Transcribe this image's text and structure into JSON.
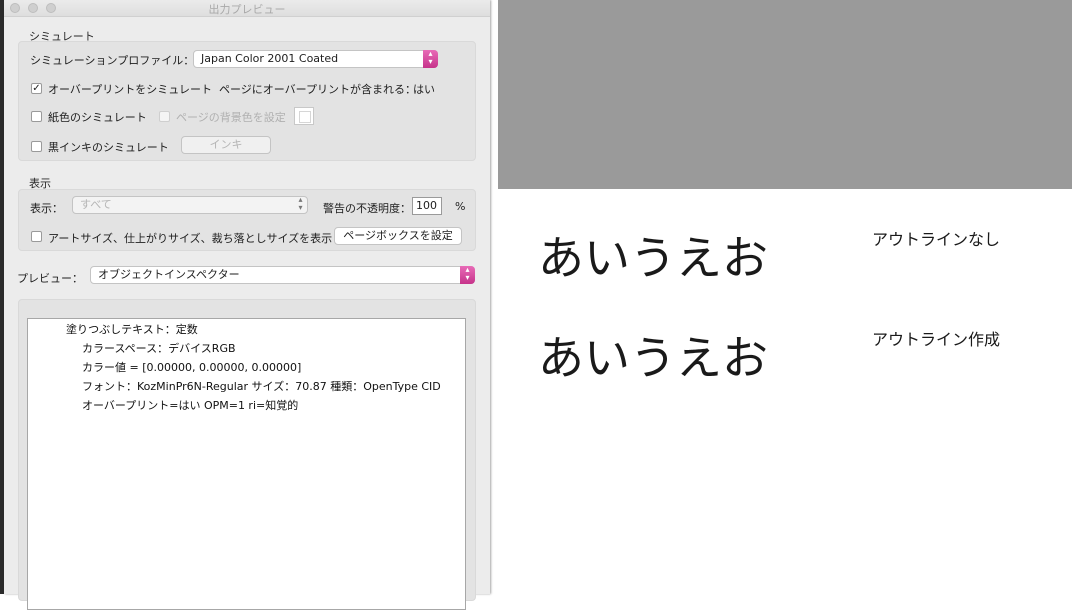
{
  "window": {
    "title": "出力プレビュー"
  },
  "simulate": {
    "section_label": "シミュレート",
    "profile_label": "シミュレーションプロファイル：",
    "profile_value": "Japan Color 2001 Coated",
    "overprint_label": "オーバープリントをシミュレート",
    "overprint_checked": "✓",
    "page_overprint_label": "ページにオーバープリントが含まれる：",
    "page_overprint_value": "はい",
    "paper_color_label": "紙色のシミュレート",
    "bg_color_label": "ページの背景色を設定",
    "black_ink_label": "黒インキのシミュレート",
    "ink_button": "インキ"
  },
  "display": {
    "section_label": "表示",
    "show_label": "表示：",
    "show_value": "すべて",
    "opacity_label": "警告の不透明度：",
    "opacity_value": "100",
    "opacity_unit": "%",
    "sizes_label": "アートサイズ、仕上がりサイズ、裁ち落としサイズを表示",
    "pagebox_button": "ページボックスを設定"
  },
  "preview": {
    "label": "プレビュー：",
    "value": "オブジェクトインスペクター"
  },
  "inspector": {
    "lines": [
      "塗りつぶしテキスト：定数",
      "カラースペース：デバイスRGB",
      "カラー値 = [0.00000, 0.00000, 0.00000]",
      "フォント：KozMinPr6N-Regular サイズ：70.87 種類：OpenType CID",
      "オーバープリント=はい OPM=1 ri=知覚的"
    ]
  },
  "canvas": {
    "sample1": "あいうえお",
    "caption1": "アウトラインなし",
    "sample2": "あいうえお",
    "caption2": "アウトライン作成"
  },
  "colors": {
    "accent": "#d6479f",
    "canvas_gray": "#9a9a9a"
  }
}
